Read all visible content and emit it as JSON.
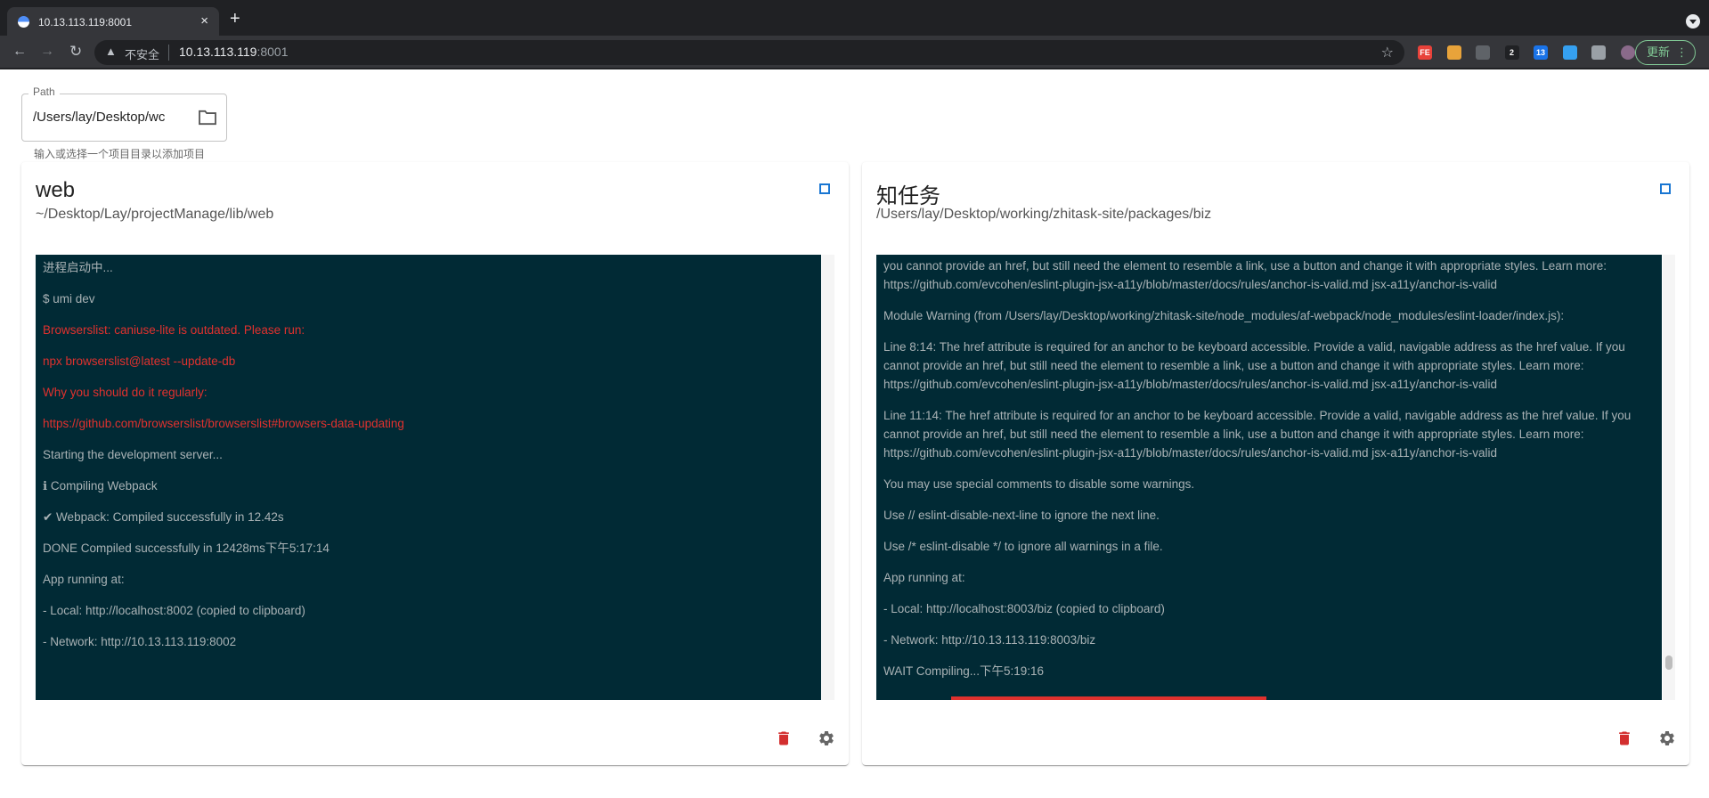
{
  "browser": {
    "tab_title": "10.13.113.119:8001",
    "tab_close": "×",
    "new_tab": "+",
    "back": "←",
    "forward": "→",
    "reload": "↻",
    "insecure_label": "不安全",
    "url_host": "10.13.113.119",
    "url_port": ":8001",
    "bookmark_star": "☆",
    "update_label": "更新",
    "update_menu": "⋮",
    "extensions": [
      {
        "name": "fe-extension-icon",
        "label": "FE",
        "color": "#e8423a"
      },
      {
        "name": "cookie-extension-icon",
        "label": "",
        "color": "#e8a33a"
      },
      {
        "name": "spy-extension-icon",
        "label": "",
        "color": "#5f6368"
      },
      {
        "name": "o-extension-icon",
        "label": "2",
        "color": "#202124"
      },
      {
        "name": "grid-extension-icon",
        "label": "13",
        "color": "#1a73e8"
      },
      {
        "name": "diamond-extension-icon",
        "label": "",
        "color": "#35a0f0"
      },
      {
        "name": "puzzle-extension-icon",
        "label": "",
        "color": "#9aa0a6"
      },
      {
        "name": "profile-avatar-icon",
        "label": "",
        "color": "#8a6a8a"
      }
    ]
  },
  "path": {
    "label": "Path",
    "value": "/Users/lay/Desktop/wc",
    "helper": "输入或选择一个项目目录以添加项目"
  },
  "projects": [
    {
      "title": "web",
      "path": "~/Desktop/Lay/projectManage/lib/web",
      "logs": [
        {
          "text": "进程启动中...",
          "error": false
        },
        {
          "text": "$ umi dev",
          "error": false
        },
        {
          "text": "Browserslist: caniuse-lite is outdated. Please run:",
          "error": true
        },
        {
          "text": "npx browserslist@latest --update-db",
          "error": true
        },
        {
          "text": "Why you should do it regularly:",
          "error": true
        },
        {
          "text": "https://github.com/browserslist/browserslist#browsers-data-updating",
          "error": true
        },
        {
          "text": "Starting the development server...",
          "error": false
        },
        {
          "text": "ℹ Compiling Webpack",
          "error": false
        },
        {
          "text": "✔ Webpack: Compiled successfully in 12.42s",
          "error": false
        },
        {
          "text": "DONE Compiled successfully in 12428ms下午5:17:14",
          "error": false
        },
        {
          "text": "App running at:",
          "error": false
        },
        {
          "text": "- Local: http://localhost:8002 (copied to clipboard)",
          "error": false
        },
        {
          "text": "- Network: http://10.13.113.119:8002",
          "error": false
        }
      ]
    },
    {
      "title": "知任务",
      "path": "/Users/lay/Desktop/working/zhitask-site/packages/biz",
      "logs": [
        {
          "text": "you cannot provide an href, but still need the element to resemble a link, use a button and change it with appropriate styles. Learn more: https://github.com/evcohen/eslint-plugin-jsx-a11y/blob/master/docs/rules/anchor-is-valid.md jsx-a11y/anchor-is-valid",
          "error": false
        },
        {
          "text": "Module Warning (from /Users/lay/Desktop/working/zhitask-site/node_modules/af-webpack/node_modules/eslint-loader/index.js):",
          "error": false
        },
        {
          "text": "Line 8:14: The href attribute is required for an anchor to be keyboard accessible. Provide a valid, navigable address as the href value. If you cannot provide an href, but still need the element to resemble a link, use a button and change it with appropriate styles. Learn more: https://github.com/evcohen/eslint-plugin-jsx-a11y/blob/master/docs/rules/anchor-is-valid.md jsx-a11y/anchor-is-valid",
          "error": false
        },
        {
          "text": "Line 11:14: The href attribute is required for an anchor to be keyboard accessible. Provide a valid, navigable address as the href value. If you cannot provide an href, but still need the element to resemble a link, use a button and change it with appropriate styles. Learn more: https://github.com/evcohen/eslint-plugin-jsx-a11y/blob/master/docs/rules/anchor-is-valid.md jsx-a11y/anchor-is-valid",
          "error": false
        },
        {
          "text": "You may use special comments to disable some warnings.",
          "error": false
        },
        {
          "text": "Use // eslint-disable-next-line to ignore the next line.",
          "error": false
        },
        {
          "text": "Use /* eslint-disable */ to ignore all warnings in a file.",
          "error": false
        },
        {
          "text": "App running at:",
          "error": false
        },
        {
          "text": "- Local: http://localhost:8003/biz (copied to clipboard)",
          "error": false
        },
        {
          "text": "- Network: http://10.13.113.119:8003/biz",
          "error": false
        },
        {
          "text": "WAIT Compiling...下午5:19:16",
          "error": false
        }
      ]
    }
  ],
  "colors": {
    "console_bg": "#012a35",
    "console_text": "#a9b2b5",
    "console_error": "#e0312e",
    "accent": "#1976d2",
    "delete": "#d32f2f"
  }
}
